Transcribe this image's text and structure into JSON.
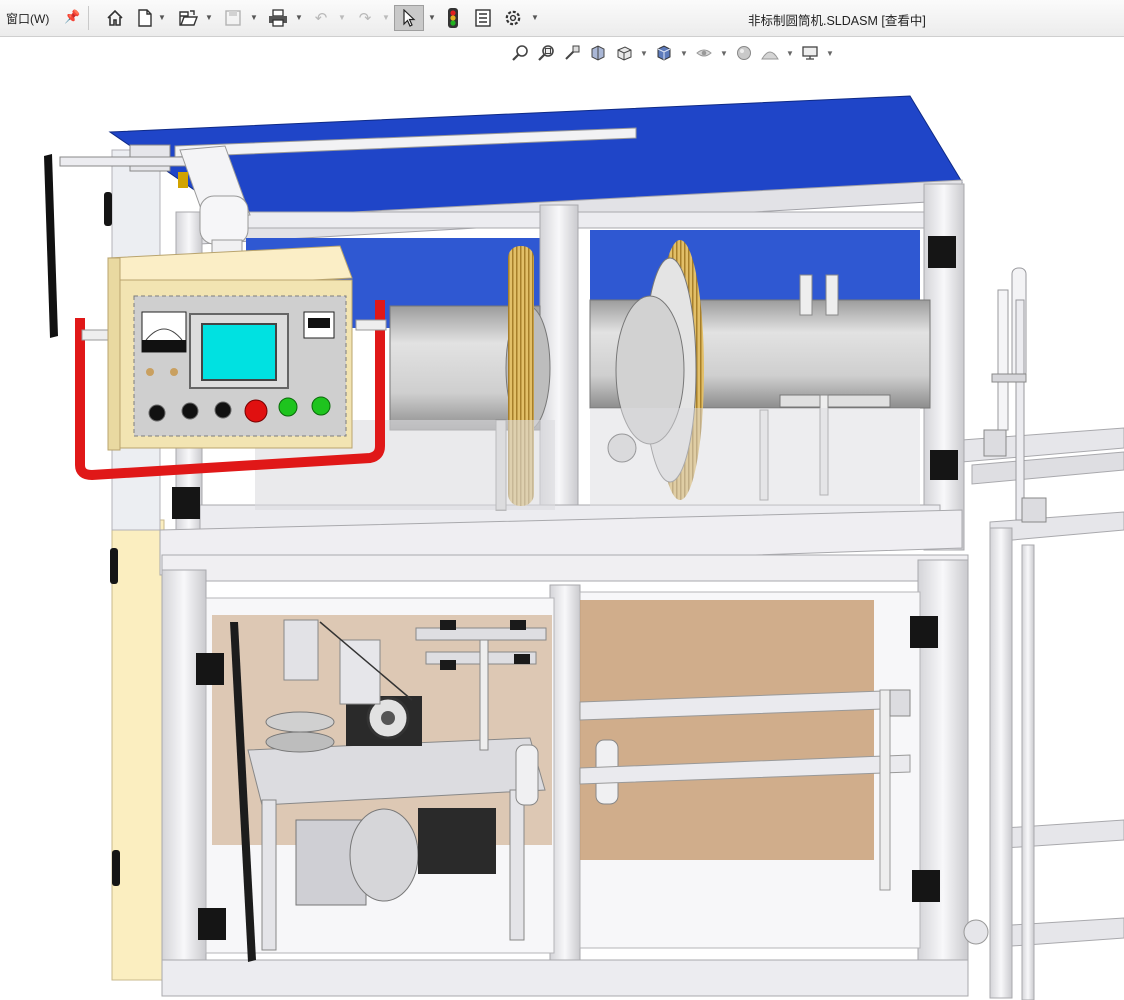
{
  "menubar": {
    "window_menu": "窗口(W)"
  },
  "document": {
    "title": "非标制圆筒机.SLDASM [查看中]"
  },
  "toolbar": {
    "items": [
      "home-icon",
      "new-document-icon",
      "open-icon",
      "save-icon",
      "print-icon",
      "undo-icon",
      "redo-icon",
      "select-icon",
      "rebuild-icon",
      "file-properties-icon",
      "options-icon"
    ]
  },
  "heads_up_toolbar": {
    "items": [
      "zoom-to-fit-icon",
      "zoom-to-area-icon",
      "previous-view-icon",
      "section-view-icon",
      "view-orientation-icon",
      "display-style-icon",
      "hide-show-items-icon",
      "edit-appearance-icon",
      "apply-scene-icon",
      "view-settings-icon"
    ]
  },
  "colors": {
    "sheet_metal_blue": "#1f45c8",
    "frame_white": "#efeef0",
    "panel_cream": "#f2e4b2",
    "handle_red": "#e01818",
    "screen_cyan": "#00e1e1",
    "stop_red": "#e01010",
    "start_green": "#1ec41e",
    "wood_panel": "#c59a6f",
    "cylinder_gray": "#c7c7c7",
    "hinge_black": "#151515",
    "gear_gold": "#d8b154"
  }
}
